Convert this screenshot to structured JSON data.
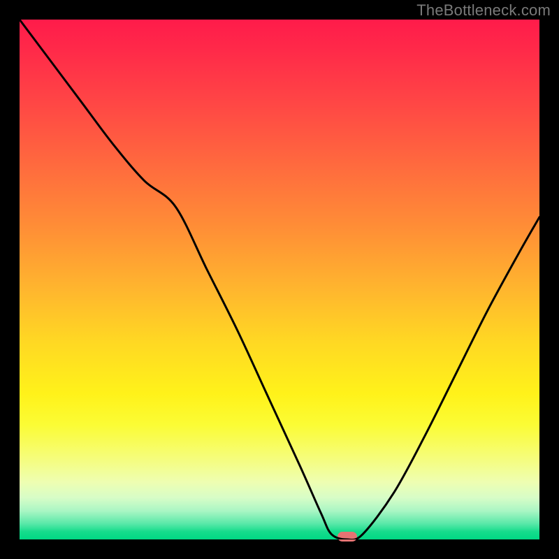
{
  "watermark": "TheBottleneck.com",
  "chart_data": {
    "type": "line",
    "title": "",
    "xlabel": "",
    "ylabel": "",
    "xlim": [
      0,
      100
    ],
    "ylim": [
      0,
      100
    ],
    "series": [
      {
        "name": "bottleneck-curve",
        "x": [
          0,
          6,
          12,
          18,
          24,
          30,
          36,
          42,
          48,
          54,
          58,
          60,
          63,
          66,
          72,
          78,
          84,
          90,
          96,
          100
        ],
        "values": [
          100,
          92,
          84,
          76,
          69,
          64,
          52,
          40,
          27,
          14,
          5,
          1,
          0,
          1,
          9,
          20,
          32,
          44,
          55,
          62
        ]
      }
    ],
    "marker": {
      "x": 63,
      "y": 0,
      "color": "#e57373"
    },
    "gradient_stops": [
      {
        "pos": 0,
        "color": "#ff1b4a"
      },
      {
        "pos": 0.5,
        "color": "#ffd823"
      },
      {
        "pos": 0.85,
        "color": "#fbfc60"
      },
      {
        "pos": 1.0,
        "color": "#00d884"
      }
    ],
    "grid": false,
    "legend": false
  }
}
